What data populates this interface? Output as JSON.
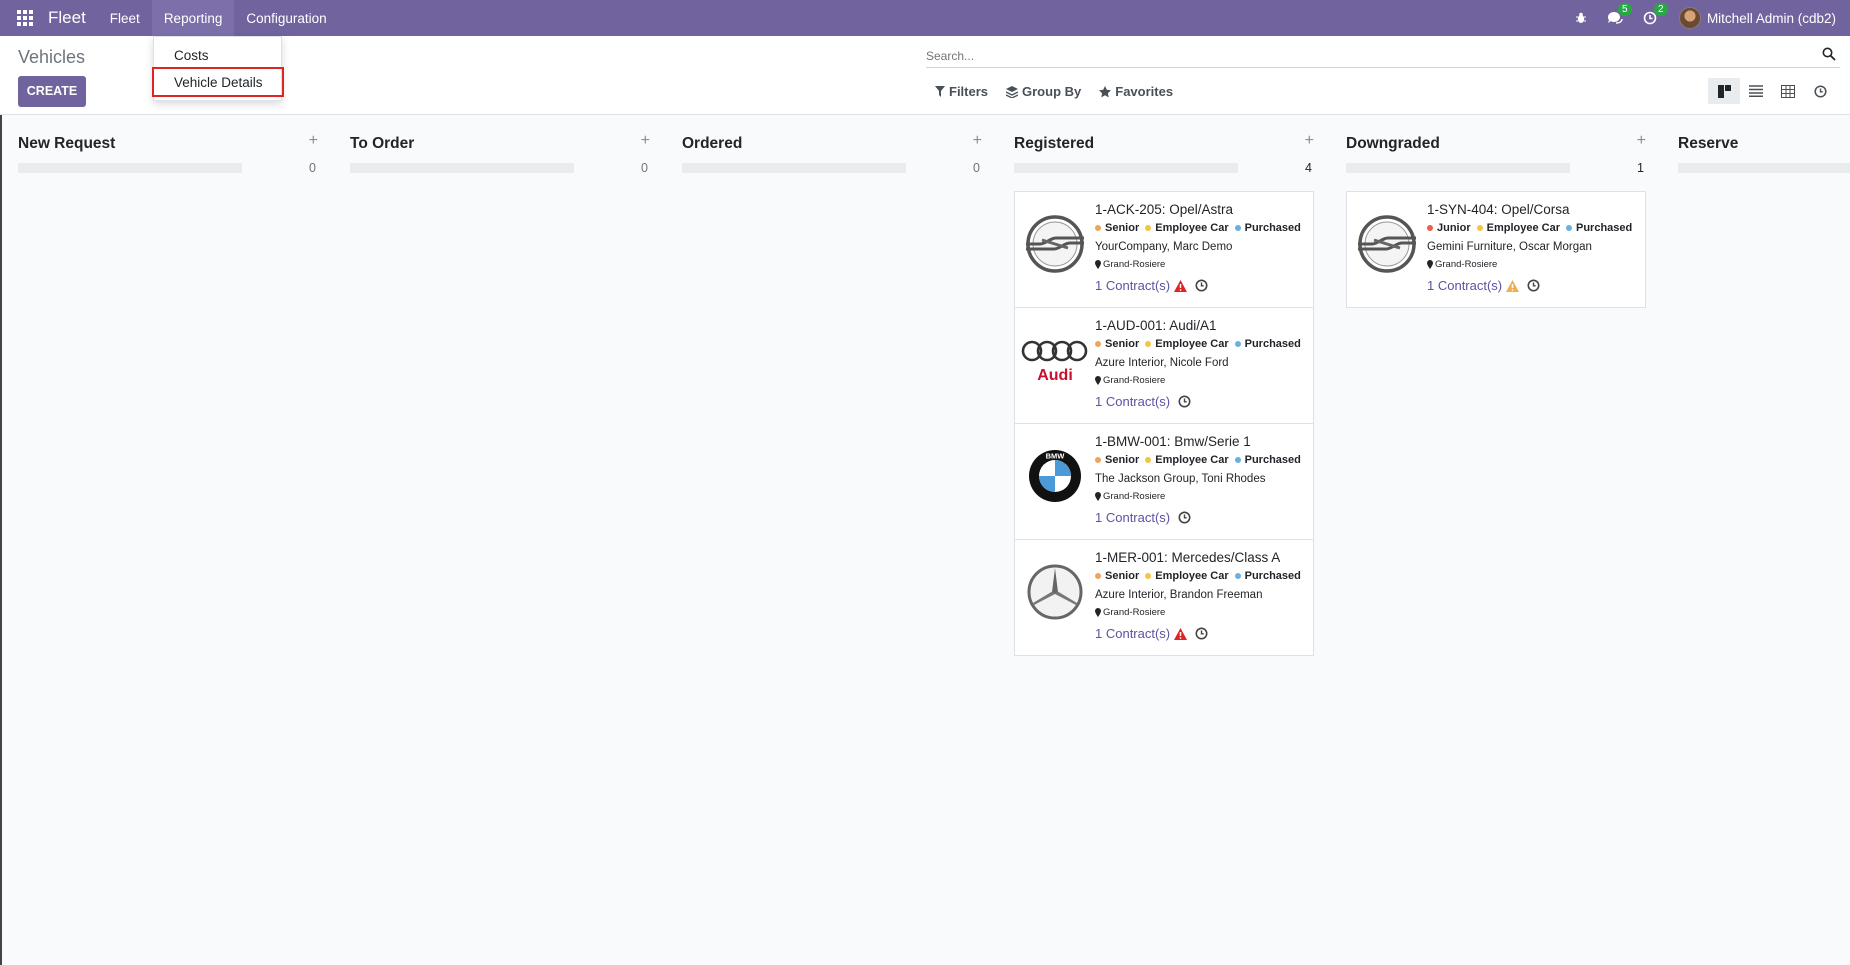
{
  "navbar": {
    "app_name": "Fleet",
    "menu": [
      "Fleet",
      "Reporting",
      "Configuration"
    ],
    "chat_count": "5",
    "activity_count": "2",
    "user": "Mitchell Admin (cdb2)"
  },
  "control_panel": {
    "title": "Vehicles",
    "create_label": "CREATE",
    "search_placeholder": "Search...",
    "filters_label": "Filters",
    "group_by_label": "Group By",
    "favorites_label": "Favorites"
  },
  "dropdown": {
    "items": [
      "Costs",
      "Vehicle Details"
    ]
  },
  "colors": {
    "brand": "#71639e",
    "senior": "#f0a35a",
    "junior": "#e8604c",
    "employee_car": "#f4c542",
    "purchased": "#6ab0de",
    "warn_red": "#e02424",
    "warn_orange": "#f0ad4e"
  },
  "columns": [
    {
      "title": "New Request",
      "count": "0"
    },
    {
      "title": "To Order",
      "count": "0"
    },
    {
      "title": "Ordered",
      "count": "0"
    },
    {
      "title": "Registered",
      "count": "4"
    },
    {
      "title": "Downgraded",
      "count": "1"
    },
    {
      "title": "Reserve",
      "count": ""
    }
  ],
  "cards": {
    "registered": [
      {
        "title": "1-ACK-205: Opel/Astra",
        "level": "Senior",
        "type": "Employee Car",
        "status": "Purchased",
        "driver": "YourCompany, Marc Demo",
        "location": "Grand-Rosiere",
        "contracts": "1 Contract(s)",
        "logo": "opel-logo",
        "warning": "red"
      },
      {
        "title": "1-AUD-001: Audi/A1",
        "level": "Senior",
        "type": "Employee Car",
        "status": "Purchased",
        "driver": "Azure Interior, Nicole Ford",
        "location": "Grand-Rosiere",
        "contracts": "1 Contract(s)",
        "logo": "audi-logo",
        "warning": "none",
        "logo_text": "Audi"
      },
      {
        "title": "1-BMW-001: Bmw/Serie 1",
        "level": "Senior",
        "type": "Employee Car",
        "status": "Purchased",
        "driver": "The Jackson Group, Toni Rhodes",
        "location": "Grand-Rosiere",
        "contracts": "1 Contract(s)",
        "logo": "bmw-logo",
        "warning": "none",
        "logo_text": "BMW"
      },
      {
        "title": "1-MER-001: Mercedes/Class A",
        "level": "Senior",
        "type": "Employee Car",
        "status": "Purchased",
        "driver": "Azure Interior, Brandon Freeman",
        "location": "Grand-Rosiere",
        "contracts": "1 Contract(s)",
        "logo": "mercedes-logo",
        "warning": "red"
      }
    ],
    "downgraded": [
      {
        "title": "1-SYN-404: Opel/Corsa",
        "level": "Junior",
        "type": "Employee Car",
        "status": "Purchased",
        "driver": "Gemini Furniture, Oscar Morgan",
        "location": "Grand-Rosiere",
        "contracts": "1 Contract(s)",
        "logo": "opel-logo",
        "warning": "orange"
      }
    ]
  }
}
